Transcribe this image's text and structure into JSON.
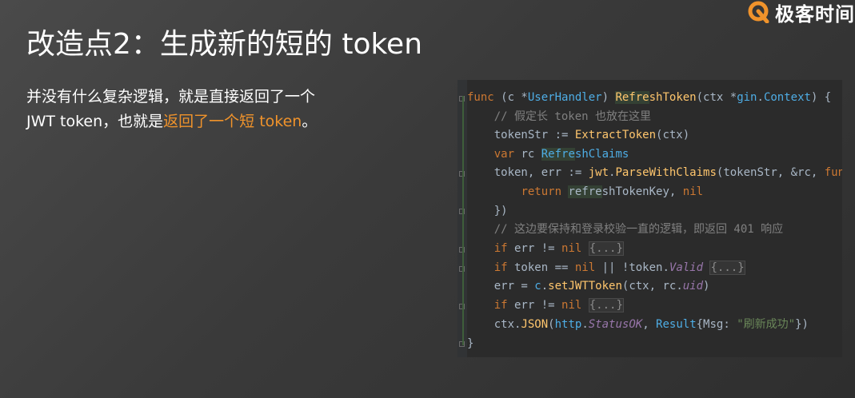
{
  "logo": {
    "text": "极客时间"
  },
  "slide": {
    "title": "改造点2：生成新的短的 token",
    "desc_line1": "并没有什么复杂逻辑，就是直接返回了一个",
    "desc_line2_pre": "JWT token，也就是",
    "desc_line2_hl": "返回了一个短 token",
    "desc_line2_post": "。"
  },
  "code": {
    "l1": {
      "a": "func",
      "b": " (c *",
      "c": "UserHandler",
      "d": ") ",
      "e": "Refre",
      "f": "shToken",
      "g": "(ctx *",
      "h": "gin",
      "i": ".",
      "j": "Context",
      "k": ") {  1"
    },
    "l2": "    // 假定长 token 也放在这里",
    "l3": {
      "a": "    tokenStr := ",
      "b": "ExtractToken",
      "c": "(ctx)"
    },
    "l4": {
      "a": "    ",
      "b": "var",
      "c": " rc ",
      "d": "Refre",
      "e": "shClaims"
    },
    "l5": {
      "a": "    token, err := ",
      "b": "jwt",
      "c": ".",
      "d": "ParseWithClaims",
      "e": "(tokenStr, &rc, ",
      "f": "func"
    },
    "l6": {
      "a": "        ",
      "b": "return",
      "c": " ",
      "d": "refre",
      "e": "shTokenKey, ",
      "f": "nil"
    },
    "l7": "    })",
    "l8": "    // 这边要保持和登录校验一直的逻辑，即返回 401 响应",
    "l9": {
      "a": "    ",
      "b": "if",
      "c": " err != ",
      "d": "nil",
      "e": " ",
      "f": "{...}"
    },
    "l10": {
      "a": "    ",
      "b": "if",
      "c": " token == ",
      "d": "nil",
      "e": " || !token.",
      "f": "Valid",
      "g": " ",
      "h": "{...}"
    },
    "l11": {
      "a": "    err = ",
      "b": "c",
      "c": ".",
      "d": "setJWTToken",
      "e": "(ctx, rc.",
      "f": "uid",
      "g": ")"
    },
    "l12": {
      "a": "    ",
      "b": "if",
      "c": " err != ",
      "d": "nil",
      "e": " ",
      "f": "{...}"
    },
    "l13": {
      "a": "    ctx.",
      "b": "JSON",
      "c": "(",
      "d": "http",
      "e": ".",
      "f": "StatusOK",
      "g": ", ",
      "h": "Result",
      "i": "{Msg: ",
      "j": "\"刷新成功\"",
      "k": "})"
    },
    "l14": "}"
  }
}
